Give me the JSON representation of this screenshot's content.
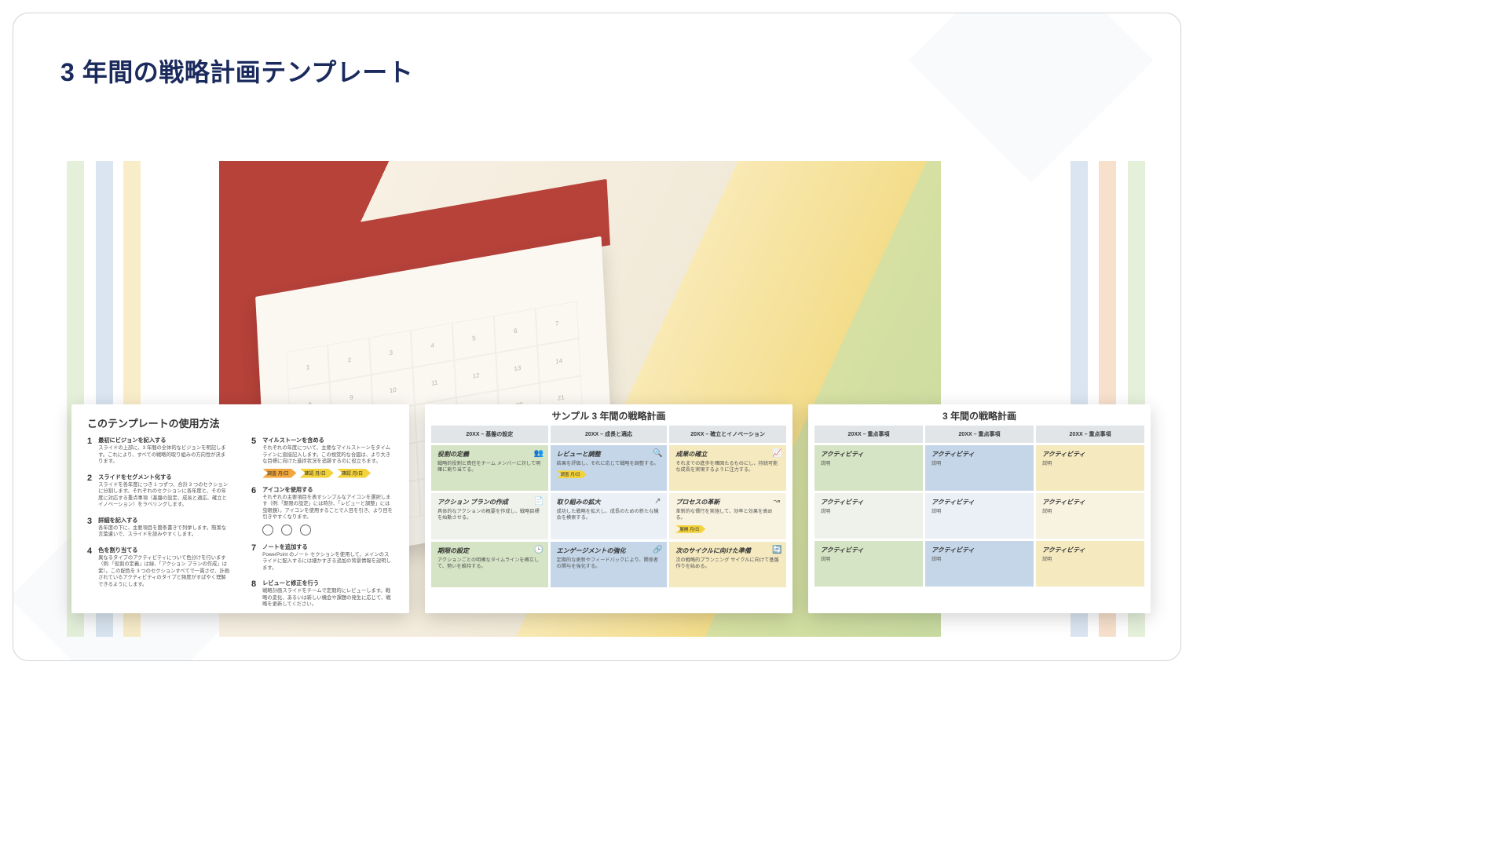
{
  "title": "3 年間の戦略計画テンプレート",
  "card1": {
    "title": "このテンプレートの使用方法",
    "left": [
      {
        "n": "1",
        "h": "最初にビジョンを記入する",
        "p": "スライドの上部に、3 年間の全体的なビジョンを明記します。これにより、すべての戦略的取り組みの方向性が決まります。"
      },
      {
        "n": "2",
        "h": "スライドをセグメント化する",
        "p": "スライドを各年度につき 1 つずつ、合計 3 つのセクションに分割します。それぞれのセクションに各年度と、その年度に対応する重点事項（基盤の設定、成長と適応、確立とイノベーション）をラベリングします。"
      },
      {
        "n": "3",
        "h": "詳細を記入する",
        "p": "各年度の下に、主要項目を箇条書きで列挙します。簡潔な言葉遣いで、スライドを読みやすくします。"
      },
      {
        "n": "4",
        "h": "色を割り当てる",
        "p": "異なるタイプのアクティビティについて色分けを行います（例:「役割の定義」は緑、「アクション プランの作成」は紫）。この配色を 3 つのセクションすべてで一貫させ、計画されているアクティビティのタイプと頻度がすばやく理解できるようにします。"
      }
    ],
    "right": [
      {
        "n": "5",
        "h": "マイルストーンを含める",
        "p": "それぞれの年度について、主要なマイルストーンをタイムラインに直接記入します。この視覚的な合図は、より大きな目標に向けた進捗状況を追跡するのに役立ちます。",
        "chips": [
          "調査 月/日",
          "確認 月/日",
          "確認 月/日"
        ]
      },
      {
        "n": "6",
        "h": "アイコンを使用する",
        "p": "それぞれの主要項目を表すシンプルなアイコンを選択します（例:「期限の設定」には時計、「レビューと調整」には虫眼鏡）。アイコンを使用することで人目を引き、より目を引きやすくなります。",
        "icons": true
      },
      {
        "n": "7",
        "h": "ノートを追加する",
        "p": "PowerPoint のノート セクションを使用して、メインのスライドに配入するには細かすぎる追加の背景情報を説明します。"
      },
      {
        "n": "8",
        "h": "レビューと修正を行う",
        "p": "戦略計画スライドをチームで定期的にレビューします。戦略の変化、あるいは新しい機会や課題の発生に応じて、戦略を更新してください。"
      }
    ]
  },
  "card2": {
    "title": "サンプル 3 年間の戦略計画",
    "heads": [
      "20XX – 基盤の設定",
      "20XX – 成長と適応",
      "20XX – 確立とイノベーション"
    ],
    "rows": [
      [
        {
          "c": "g",
          "h": "役割の定義",
          "p": "戦略的役割と責任をチーム メンバーに対して明確に割り当てる。",
          "icon": "people"
        },
        {
          "c": "b",
          "h": "レビューと調整",
          "p": "結果を評価し、それに応じて戦略を調整する。",
          "icon": "search",
          "chip": "調査 月/日"
        },
        {
          "c": "y",
          "h": "成果の確立",
          "p": "それまでの進歩を確固たるものにし、持続可能な成長を実現するように注力する。",
          "icon": "chart"
        }
      ],
      [
        {
          "c": "gh",
          "h": "アクション プランの作成",
          "p": "具体的なアクションの概要を作成し、戦略目標を始動させる。",
          "icon": "doc"
        },
        {
          "c": "bh",
          "h": "取り組みの拡大",
          "p": "成功した戦略を拡大し、成長のための新たな機会を模索する。",
          "icon": "expand"
        },
        {
          "c": "yh",
          "h": "プロセスの革新",
          "p": "革新的な慣行を実施して、効率と効果を高める。",
          "icon": "flow",
          "chip": "展開 月/日"
        }
      ],
      [
        {
          "c": "g",
          "h": "期限の設定",
          "p": "アクションごとの明確なタイムラインを確立して、勢いを維持する。",
          "icon": "clock"
        },
        {
          "c": "b",
          "h": "エンゲージメントの強化",
          "p": "定期的な更新やフィードバックにより、関係者の関与を強化する。",
          "icon": "share"
        },
        {
          "c": "y",
          "h": "次のサイクルに向けた準備",
          "p": "次の戦略的プランニング サイクルに向けて基盤作りを始める。",
          "icon": "refresh"
        }
      ]
    ]
  },
  "card3": {
    "title": "3 年間の戦略計画",
    "heads": [
      "20XX – 重点事項",
      "20XX – 重点事項",
      "20XX – 重点事項"
    ],
    "rows": [
      [
        {
          "c": "g",
          "h": "アクティビティ",
          "p": "説明"
        },
        {
          "c": "b",
          "h": "アクティビティ",
          "p": "説明"
        },
        {
          "c": "y",
          "h": "アクティビティ",
          "p": "説明"
        }
      ],
      [
        {
          "c": "gh",
          "h": "アクティビティ",
          "p": "説明"
        },
        {
          "c": "bh",
          "h": "アクティビティ",
          "p": "説明"
        },
        {
          "c": "yh",
          "h": "アクティビティ",
          "p": "説明"
        }
      ],
      [
        {
          "c": "g",
          "h": "アクティビティ",
          "p": "説明"
        },
        {
          "c": "b",
          "h": "アクティビティ",
          "p": "説明"
        },
        {
          "c": "y",
          "h": "アクティビティ",
          "p": "説明"
        }
      ]
    ]
  },
  "icons": {
    "people": "👥",
    "search": "🔍",
    "chart": "📈",
    "doc": "📄",
    "expand": "↗",
    "flow": "↝",
    "clock": "🕒",
    "share": "🔗",
    "refresh": "🔄"
  }
}
